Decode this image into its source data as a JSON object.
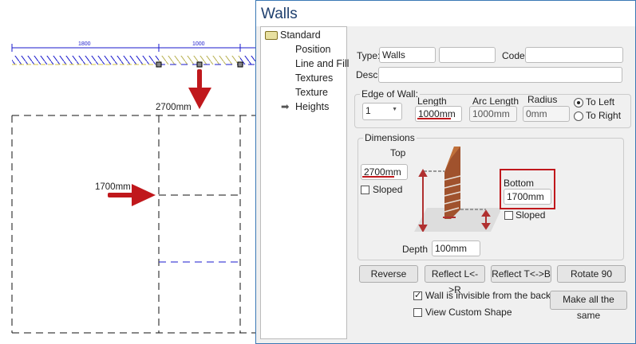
{
  "drawing": {
    "dim_left": "1800",
    "dim_right": "1000",
    "top_label": "2700mm",
    "bottom_label": "1700mm"
  },
  "dialog": {
    "title": "Walls",
    "tree": {
      "root": "Standard",
      "items": [
        "Position",
        "Line and Fill",
        "Textures",
        "Texture",
        "Heights"
      ],
      "selected": "Heights"
    },
    "type_label": "Type:",
    "type_value": "Walls",
    "type_value2": "",
    "code_label": "Code:",
    "code_value": "",
    "desc_label": "Desc:",
    "desc_value": "",
    "edge": {
      "caption": "Edge of Wall:",
      "edge_value": "1",
      "length_label": "Length",
      "length_value": "1000mm",
      "arc_label": "Arc Length",
      "arc_value": "1000mm",
      "radius_label": "Radius",
      "radius_value": "0mm",
      "to_left": "To Left",
      "to_right": "To Right",
      "selected": "To Left"
    },
    "dimensions": {
      "caption": "Dimensions",
      "top_label": "Top",
      "top_value": "2700mm",
      "top_sloped": "Sloped",
      "bottom_label": "Bottom",
      "bottom_value": "1700mm",
      "bottom_sloped": "Sloped",
      "depth_label": "Depth",
      "depth_value": "100mm"
    },
    "buttons": {
      "reverse": "Reverse",
      "reflect_lr": "Reflect L<->R",
      "reflect_tb": "Reflect T<->B",
      "rotate": "Rotate 90",
      "make_same": "Make all the same"
    },
    "invisible_back": "Wall is invisible from the back",
    "invisible_checked": true,
    "custom_shape": "View Custom Shape",
    "custom_checked": false,
    "colors": {
      "accent_red": "#c0181c",
      "plan_blue": "#1a1acc"
    }
  }
}
